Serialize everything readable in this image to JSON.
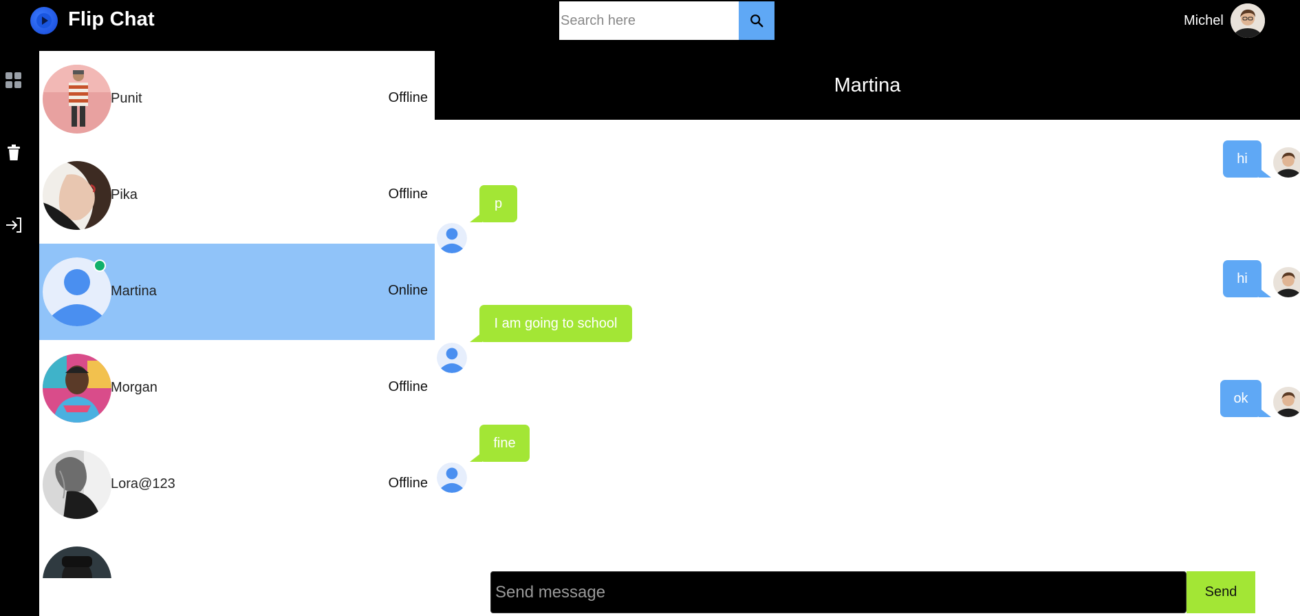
{
  "app": {
    "title": "Flip Chat",
    "logo_icon": "play-circle-icon"
  },
  "search": {
    "placeholder": "Search here",
    "value": "",
    "icon": "search-icon"
  },
  "user": {
    "name": "Michel"
  },
  "rail": {
    "items": [
      {
        "icon": "grid-icon"
      },
      {
        "icon": "trash-icon"
      },
      {
        "icon": "logout-icon"
      }
    ]
  },
  "contacts": [
    {
      "name": "Punit",
      "status": "Offline"
    },
    {
      "name": "Pika",
      "status": "Offline"
    },
    {
      "name": "Martina",
      "status": "Online",
      "active": true
    },
    {
      "name": "Morgan",
      "status": "Offline"
    },
    {
      "name": "Lora@123",
      "status": "Offline"
    }
  ],
  "chat": {
    "header": "Martina",
    "messages": [
      {
        "direction": "out",
        "text": "hi"
      },
      {
        "direction": "in",
        "text": "p"
      },
      {
        "direction": "out",
        "text": "hi"
      },
      {
        "direction": "in",
        "text": "I am going to school"
      },
      {
        "direction": "out",
        "text": "ok"
      },
      {
        "direction": "in",
        "text": "fine"
      }
    ]
  },
  "composer": {
    "placeholder": "Send message",
    "value": "",
    "send_label": "Send"
  },
  "colors": {
    "accent_blue": "#5fa8f5",
    "accent_green": "#a3e635",
    "active_row": "#90c3f9",
    "online": "#10b06a"
  }
}
